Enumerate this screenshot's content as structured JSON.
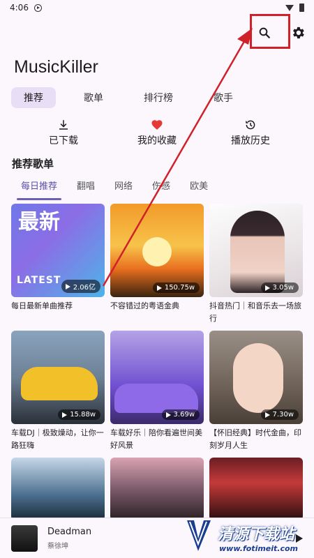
{
  "status_bar": {
    "time": "4:06"
  },
  "app": {
    "title": "MusicKiller"
  },
  "tabs": [
    {
      "label": "推荐",
      "active": true
    },
    {
      "label": "歌单",
      "active": false
    },
    {
      "label": "排行榜",
      "active": false
    },
    {
      "label": "歌手",
      "active": false
    }
  ],
  "quick_actions": [
    {
      "label": "已下载",
      "icon": "download-icon"
    },
    {
      "label": "我的收藏",
      "icon": "heart-icon"
    },
    {
      "label": "播放历史",
      "icon": "history-icon"
    }
  ],
  "section": {
    "title": "推荐歌单"
  },
  "sub_tabs": [
    {
      "label": "每日推荐",
      "active": true
    },
    {
      "label": "翻唱",
      "active": false
    },
    {
      "label": "网络",
      "active": false
    },
    {
      "label": "伤感",
      "active": false
    },
    {
      "label": "欧美",
      "active": false
    }
  ],
  "playlists": [
    {
      "title": "每日最新单曲推荐",
      "count": "2.06亿",
      "cover_text_big": "最新",
      "cover_text_small": "LATEST"
    },
    {
      "title": "不容错过的粤语金典",
      "count": "150.75w"
    },
    {
      "title": "抖音热门｜和音乐去一场旅行",
      "count": "3.05w"
    },
    {
      "title": "车载DJ｜极致燥动，让你一路狂嗨",
      "count": "15.88w"
    },
    {
      "title": "车载好乐｜陪你看遍世间美好风景",
      "count": "3.69w"
    },
    {
      "title": "【怀旧经典】时代金曲，印刻岁月人生",
      "count": "7.30w"
    },
    {
      "title": "",
      "count": ""
    },
    {
      "title": "",
      "count": ""
    },
    {
      "title": "",
      "count": ""
    }
  ],
  "now_playing": {
    "song": "Deadman",
    "artist": "蔡徐坤"
  },
  "watermark": {
    "site_name": "清源下载站",
    "site_url": "www.fotimeit.com"
  },
  "colors": {
    "accent": "#6b5fb9",
    "tab_active_bg": "#e8def5",
    "annotation": "#d0202a",
    "heart": "#e53935"
  }
}
